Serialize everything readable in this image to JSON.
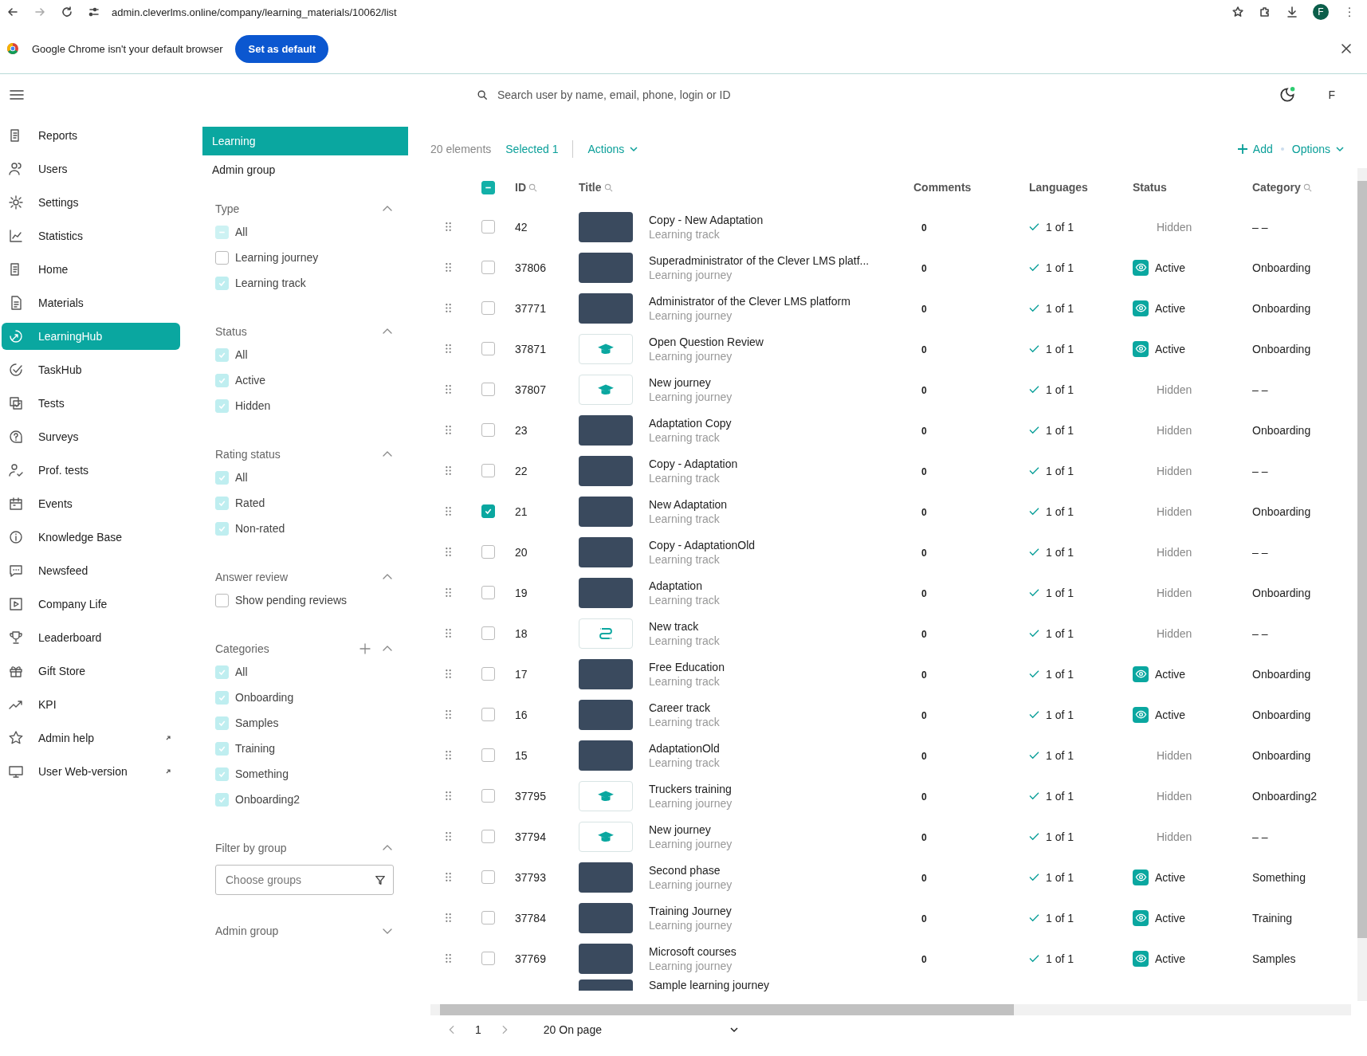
{
  "browser": {
    "url": "admin.cleverlms.online/company/learning_materials/10062/list",
    "profile": "F",
    "infobar": {
      "message": "Google Chrome isn't your default browser",
      "button": "Set as default"
    }
  },
  "header": {
    "search_placeholder": "Search user by name, email, phone, login or ID",
    "avatar": "F"
  },
  "nav": [
    {
      "label": "Reports",
      "selected": false,
      "external": false
    },
    {
      "label": "Users",
      "selected": false,
      "external": false
    },
    {
      "label": "Settings",
      "selected": false,
      "external": false
    },
    {
      "label": "Statistics",
      "selected": false,
      "external": false
    },
    {
      "label": "Home",
      "selected": false,
      "external": false
    },
    {
      "label": "Materials",
      "selected": false,
      "external": false
    },
    {
      "label": "LearningHub",
      "selected": true,
      "external": false
    },
    {
      "label": "TaskHub",
      "selected": false,
      "external": false
    },
    {
      "label": "Tests",
      "selected": false,
      "external": false
    },
    {
      "label": "Surveys",
      "selected": false,
      "external": false
    },
    {
      "label": "Prof. tests",
      "selected": false,
      "external": false
    },
    {
      "label": "Events",
      "selected": false,
      "external": false
    },
    {
      "label": "Knowledge Base",
      "selected": false,
      "external": false
    },
    {
      "label": "Newsfeed",
      "selected": false,
      "external": false
    },
    {
      "label": "Company Life",
      "selected": false,
      "external": false
    },
    {
      "label": "Leaderboard",
      "selected": false,
      "external": false
    },
    {
      "label": "Gift Store",
      "selected": false,
      "external": false
    },
    {
      "label": "KPI",
      "selected": false,
      "external": false
    },
    {
      "label": "Admin help",
      "selected": false,
      "external": true
    },
    {
      "label": "User Web-version",
      "selected": false,
      "external": true
    }
  ],
  "groups": [
    {
      "label": "Learning",
      "selected": true
    },
    {
      "label": "Admin group",
      "selected": false
    }
  ],
  "filters": [
    {
      "kind": "checklist",
      "title": "Type",
      "expanded": true,
      "options": [
        {
          "label": "All",
          "checked": false,
          "partial": true
        },
        {
          "label": "Learning journey",
          "checked": false,
          "partial": false
        },
        {
          "label": "Learning track",
          "checked": true,
          "partial": false
        }
      ]
    },
    {
      "kind": "checklist",
      "title": "Status",
      "expanded": true,
      "options": [
        {
          "label": "All",
          "checked": true,
          "partial": false
        },
        {
          "label": "Active",
          "checked": true,
          "partial": false
        },
        {
          "label": "Hidden",
          "checked": true,
          "partial": false
        }
      ]
    },
    {
      "kind": "checklist",
      "title": "Rating status",
      "expanded": true,
      "options": [
        {
          "label": "All",
          "checked": true,
          "partial": false
        },
        {
          "label": "Rated",
          "checked": true,
          "partial": false
        },
        {
          "label": "Non-rated",
          "checked": true,
          "partial": false
        }
      ]
    },
    {
      "kind": "checklist",
      "title": "Answer review",
      "expanded": true,
      "options": [
        {
          "label": "Show pending reviews",
          "checked": false,
          "partial": false
        }
      ]
    },
    {
      "kind": "category-list",
      "title": "Categories",
      "expanded": true,
      "options": [
        {
          "label": "All",
          "checked": true,
          "partial": false
        },
        {
          "label": "Onboarding",
          "checked": true,
          "partial": false
        },
        {
          "label": "Samples",
          "checked": true,
          "partial": false
        },
        {
          "label": "Training",
          "checked": true,
          "partial": false
        },
        {
          "label": "Something",
          "checked": true,
          "partial": false
        },
        {
          "label": "Onboarding2",
          "checked": true,
          "partial": false
        }
      ]
    },
    {
      "kind": "group-select",
      "title": "Filter by group",
      "expanded": true,
      "placeholder": "Choose groups"
    },
    {
      "title": "Admin group",
      "expanded": false
    }
  ],
  "toolbar": {
    "count": "20 elements",
    "selected": "Selected 1",
    "actions": "Actions",
    "add": "Add",
    "options": "Options"
  },
  "table": {
    "header_checkbox": {
      "partial": true
    },
    "columns": [
      {
        "label": "ID",
        "searchable": true
      },
      {
        "label": "Title",
        "searchable": true
      },
      {
        "label": "Comments",
        "searchable": false
      },
      {
        "label": "Languages",
        "searchable": false
      },
      {
        "label": "Status",
        "searchable": false
      },
      {
        "label": "Category",
        "searchable": true
      }
    ],
    "rows": [
      {
        "id": "42",
        "kind": "image",
        "title": "Copy - New Adaptation",
        "type": "Learning track",
        "comments": "0",
        "languages": "1 of 1",
        "status": "Hidden",
        "active": false,
        "category": "– –",
        "selected": false
      },
      {
        "id": "37806",
        "kind": "image",
        "title": "Superadministrator of the Clever LMS platf...",
        "type": "Learning journey",
        "comments": "0",
        "languages": "1 of 1",
        "status": "Active",
        "active": true,
        "category": "Onboarding",
        "selected": false
      },
      {
        "id": "37771",
        "kind": "image",
        "title": "Administrator of the Clever LMS platform",
        "type": "Learning journey",
        "comments": "0",
        "languages": "1 of 1",
        "status": "Active",
        "active": true,
        "category": "Onboarding",
        "selected": false
      },
      {
        "id": "37871",
        "kind": "cap",
        "title": "Open Question Review",
        "type": "Learning journey",
        "comments": "0",
        "languages": "1 of 1",
        "status": "Active",
        "active": true,
        "category": "Onboarding",
        "selected": false
      },
      {
        "id": "37807",
        "kind": "cap",
        "title": "New journey",
        "type": "Learning journey",
        "comments": "0",
        "languages": "1 of 1",
        "status": "Hidden",
        "active": false,
        "category": "– –",
        "selected": false
      },
      {
        "id": "23",
        "kind": "image",
        "title": "Adaptation Copy",
        "type": "Learning track",
        "comments": "0",
        "languages": "1 of 1",
        "status": "Hidden",
        "active": false,
        "category": "Onboarding",
        "selected": false
      },
      {
        "id": "22",
        "kind": "image",
        "title": "Copy - Adaptation",
        "type": "Learning track",
        "comments": "0",
        "languages": "1 of 1",
        "status": "Hidden",
        "active": false,
        "category": "– –",
        "selected": false
      },
      {
        "id": "21",
        "kind": "image",
        "title": "New Adaptation",
        "type": "Learning track",
        "comments": "0",
        "languages": "1 of 1",
        "status": "Hidden",
        "active": false,
        "category": "Onboarding",
        "selected": true
      },
      {
        "id": "20",
        "kind": "image",
        "title": "Copy - AdaptationOld",
        "type": "Learning track",
        "comments": "0",
        "languages": "1 of 1",
        "status": "Hidden",
        "active": false,
        "category": "– –",
        "selected": false
      },
      {
        "id": "19",
        "kind": "image",
        "title": "Adaptation",
        "type": "Learning track",
        "comments": "0",
        "languages": "1 of 1",
        "status": "Hidden",
        "active": false,
        "category": "Onboarding",
        "selected": false
      },
      {
        "id": "18",
        "kind": "route",
        "title": "New track",
        "type": "Learning track",
        "comments": "0",
        "languages": "1 of 1",
        "status": "Hidden",
        "active": false,
        "category": "– –",
        "selected": false
      },
      {
        "id": "17",
        "kind": "image",
        "title": "Free Education",
        "type": "Learning track",
        "comments": "0",
        "languages": "1 of 1",
        "status": "Active",
        "active": true,
        "category": "Onboarding",
        "selected": false
      },
      {
        "id": "16",
        "kind": "image",
        "title": "Career track",
        "type": "Learning track",
        "comments": "0",
        "languages": "1 of 1",
        "status": "Active",
        "active": true,
        "category": "Onboarding",
        "selected": false
      },
      {
        "id": "15",
        "kind": "image",
        "title": "AdaptationOld",
        "type": "Learning track",
        "comments": "0",
        "languages": "1 of 1",
        "status": "Hidden",
        "active": false,
        "category": "Onboarding",
        "selected": false
      },
      {
        "id": "37795",
        "kind": "cap",
        "title": "Truckers training",
        "type": "Learning journey",
        "comments": "0",
        "languages": "1 of 1",
        "status": "Hidden",
        "active": false,
        "category": "Onboarding2",
        "selected": false
      },
      {
        "id": "37794",
        "kind": "cap",
        "title": "New journey",
        "type": "Learning journey",
        "comments": "0",
        "languages": "1 of 1",
        "status": "Hidden",
        "active": false,
        "category": "– –",
        "selected": false
      },
      {
        "id": "37793",
        "kind": "image",
        "title": "Second phase",
        "type": "Learning journey",
        "comments": "0",
        "languages": "1 of 1",
        "status": "Active",
        "active": true,
        "category": "Something",
        "selected": false
      },
      {
        "id": "37784",
        "kind": "image",
        "title": "Training Journey",
        "type": "Learning journey",
        "comments": "0",
        "languages": "1 of 1",
        "status": "Active",
        "active": true,
        "category": "Training",
        "selected": false
      },
      {
        "id": "37769",
        "kind": "image",
        "title": "Microsoft courses",
        "type": "Learning journey",
        "comments": "0",
        "languages": "1 of 1",
        "status": "Active",
        "active": true,
        "category": "Samples",
        "selected": false
      }
    ],
    "partial_row": {
      "title": "Sample learning journey"
    }
  },
  "pagination": {
    "page": "1",
    "per_page": "20 On page"
  }
}
